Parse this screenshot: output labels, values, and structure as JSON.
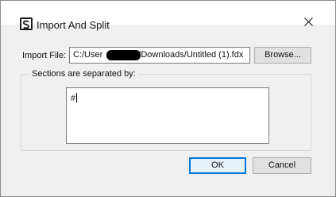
{
  "window": {
    "title": "Import And Split",
    "app_icon": "final-draft-s-icon",
    "close_icon": "close-icon"
  },
  "import_file": {
    "label": "Import File:",
    "value_prefix": "C:/User",
    "value_suffix": "/Downloads/Untitled (1).fdx",
    "browse_label": "Browse..."
  },
  "sections": {
    "group_label": "Sections are separated by:",
    "separator_value": "#"
  },
  "footer": {
    "ok_label": "OK",
    "cancel_label": "Cancel"
  },
  "colors": {
    "dialog_bg": "#f0f0f0",
    "default_button_border": "#0078d7",
    "default_button_bg": "#e5f1fb"
  }
}
